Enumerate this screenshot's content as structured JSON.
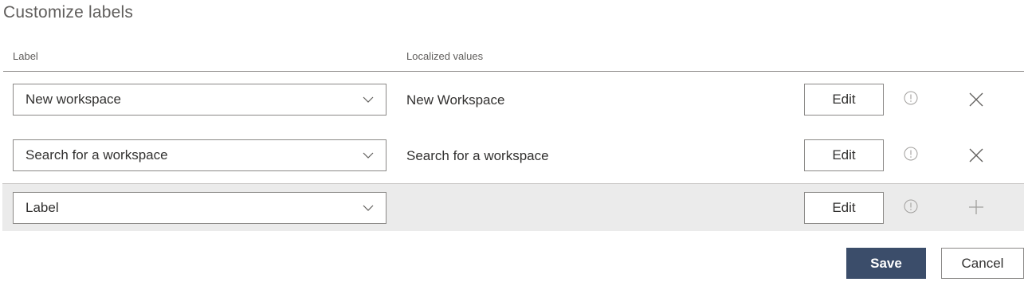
{
  "title": "Customize labels",
  "columns": {
    "label": "Label",
    "localized_values": "Localized values"
  },
  "rows": [
    {
      "label": "New workspace",
      "localized": "New Workspace",
      "edit": "Edit",
      "action_icon": "close-icon"
    },
    {
      "label": "Search for a workspace",
      "localized": "Search for a workspace",
      "edit": "Edit",
      "action_icon": "close-icon"
    }
  ],
  "new_row": {
    "placeholder": "Label",
    "localized": "",
    "edit": "Edit",
    "action_icon": "plus-icon"
  },
  "footer": {
    "save": "Save",
    "cancel": "Cancel"
  },
  "colors": {
    "primary_button": "#3b4d6a",
    "new_row_background": "#ebebeb",
    "border": "#8a8886"
  }
}
